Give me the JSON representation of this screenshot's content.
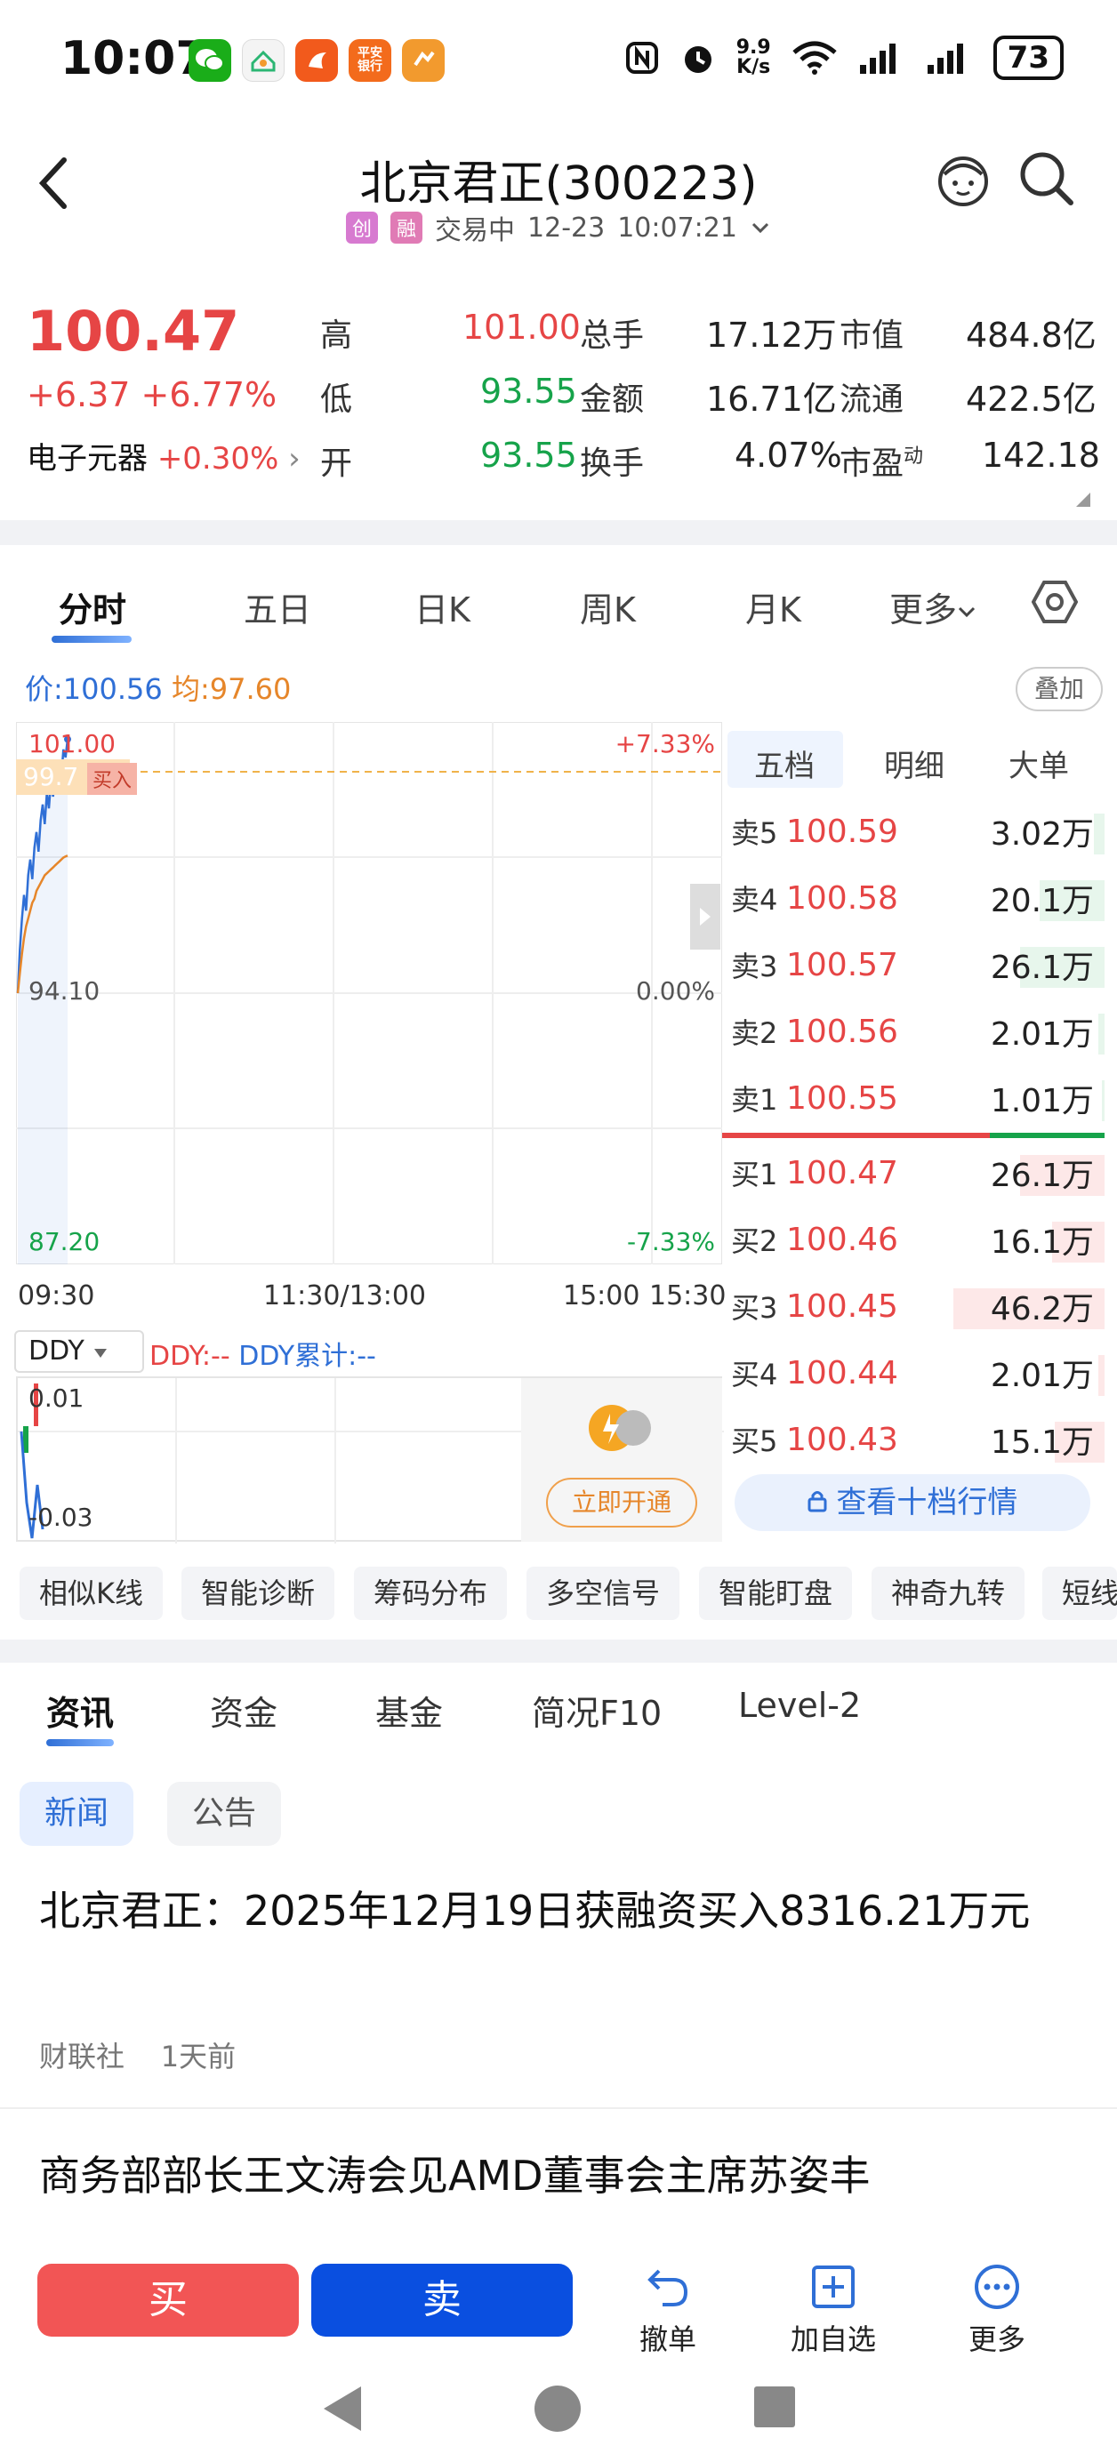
{
  "status_bar": {
    "time": "10:07",
    "net_speed_top": "9.9",
    "net_speed_bottom": "K/s",
    "battery": "73",
    "app_icons": [
      "wechat-icon",
      "cloud-app-icon",
      "fire-app-icon",
      "ping-an-bank-icon",
      "orange-app-icon"
    ],
    "ping_an_label": "平安\n银行"
  },
  "header": {
    "title": "北京君正(300223)",
    "tag1": "创",
    "tag2": "融",
    "status": "交易中",
    "date": "12-23",
    "time": "10:07:21"
  },
  "quote": {
    "price": "100.47",
    "change": "+6.37",
    "change_pct": "+6.77%",
    "sector": "电子元器",
    "sector_pct": "+0.30%",
    "high_label": "高",
    "high": "101.00",
    "low_label": "低",
    "low": "93.55",
    "open_label": "开",
    "open": "93.55",
    "vol_label": "总手",
    "vol": "17.12万",
    "amount_label": "金额",
    "amount": "16.71亿",
    "turnover_label": "换手",
    "turnover": "4.07%",
    "mcap_label": "市值",
    "mcap": "484.8亿",
    "float_label": "流通",
    "float": "422.5亿",
    "pe_label": "市盈",
    "pe_sup": "动",
    "pe": "142.18"
  },
  "chart_tabs": [
    "分时",
    "五日",
    "日K",
    "周K",
    "月K",
    "更多"
  ],
  "chart_info": {
    "price_label": "价:100.56",
    "avg_label": "均:97.60",
    "overlay_button": "叠加"
  },
  "chart_data": {
    "type": "line",
    "y_top_label": "101.00",
    "y_mid_label": "94.10",
    "y_bottom_label": "87.20",
    "pct_top": "+7.33%",
    "pct_mid": "0.00%",
    "pct_bottom": "-7.33%",
    "buy_marker_price": "99.7",
    "buy_marker_label": "买入",
    "x_labels": [
      "09:30",
      "11:30/13:00",
      "15:00",
      "15:30"
    ],
    "ylim": [
      87.2,
      101.0
    ],
    "series": [
      {
        "values": [
          94.1,
          95.2,
          96.0,
          96.6,
          96.2,
          97.1,
          97.5,
          97.0,
          97.8,
          98.2,
          97.7,
          98.5,
          98.9,
          98.4,
          99.2,
          98.8,
          99.5,
          99.1,
          99.8,
          99.4,
          100.0,
          99.6,
          100.3,
          100.1,
          100.56
        ]
      },
      {
        "values": [
          94.1,
          94.6,
          95.1,
          95.5,
          95.8,
          96.0,
          96.2,
          96.4,
          96.5,
          96.7,
          96.8,
          96.9,
          97.0,
          97.1,
          97.15,
          97.2,
          97.25,
          97.3,
          97.35,
          97.4,
          97.45,
          97.5,
          97.55,
          97.58,
          97.6
        ]
      }
    ]
  },
  "ddy": {
    "selector": "DDY",
    "ddy_label": "DDY:--",
    "ddy_cum_label": "DDY累计:--",
    "top_value": "0.01",
    "bottom_value": "-0.03",
    "promo_button": "立即开通"
  },
  "orderbook": {
    "tabs": [
      "五档",
      "明细",
      "大单"
    ],
    "asks": [
      {
        "label": "卖5",
        "price": "100.59",
        "vol": "3.02万",
        "ratio": 0.07
      },
      {
        "label": "卖4",
        "price": "100.58",
        "vol": "20.1万",
        "ratio": 0.43
      },
      {
        "label": "卖3",
        "price": "100.57",
        "vol": "26.1万",
        "ratio": 0.56
      },
      {
        "label": "卖2",
        "price": "100.56",
        "vol": "2.01万",
        "ratio": 0.04
      },
      {
        "label": "卖1",
        "price": "100.55",
        "vol": "1.01万",
        "ratio": 0.02
      }
    ],
    "bids": [
      {
        "label": "买1",
        "price": "100.47",
        "vol": "26.1万",
        "ratio": 0.56
      },
      {
        "label": "买2",
        "price": "100.46",
        "vol": "16.1万",
        "ratio": 0.35
      },
      {
        "label": "买3",
        "price": "100.45",
        "vol": "46.2万",
        "ratio": 1.0
      },
      {
        "label": "买4",
        "price": "100.44",
        "vol": "2.01万",
        "ratio": 0.04
      },
      {
        "label": "买5",
        "price": "100.43",
        "vol": "15.1万",
        "ratio": 0.33
      }
    ],
    "ten_level_button": "查看十档行情"
  },
  "feature_chips": [
    "相似K线",
    "智能诊断",
    "筹码分布",
    "多空信号",
    "智能盯盘",
    "神奇九转",
    "短线"
  ],
  "news_tabs": [
    "资讯",
    "资金",
    "基金",
    "简况F10",
    "Level-2"
  ],
  "news_filters": [
    "新闻",
    "公告"
  ],
  "news": [
    {
      "title": "北京君正：2025年12月19日获融资买入8316.21万元",
      "source": "财联社",
      "time": "1天前"
    },
    {
      "title": "商务部部长王文涛会见AMD董事会主席苏姿丰",
      "source": "",
      "time": ""
    }
  ],
  "bottom_bar": {
    "buy": "买",
    "sell": "卖",
    "cancel": "撤单",
    "add_watch": "加自选",
    "more": "更多"
  },
  "colors": {
    "up": "#e64545",
    "down": "#16a34a",
    "accent": "#2f6fd6",
    "sell_button": "#0a4fe0",
    "buy_button": "#f25555"
  }
}
